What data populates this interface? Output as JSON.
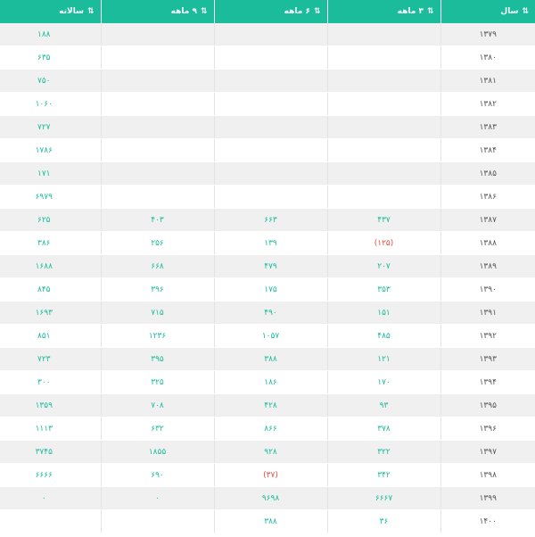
{
  "columns": {
    "year": "سال",
    "m3": "۳ ماهه",
    "m6": "۶ ماهه",
    "m9": "۹ ماهه",
    "annual": "سالانه"
  },
  "colors": {
    "header_bg": "#1abc9c",
    "value": "#1abc9c",
    "negative": "#e74c3c"
  },
  "icons": {
    "sort": "sort-arrows-icon"
  },
  "rows": [
    {
      "year": "۱۳۷۹",
      "m3": "",
      "m6": "",
      "m9": "",
      "annual": "۱۸۸"
    },
    {
      "year": "۱۳۸۰",
      "m3": "",
      "m6": "",
      "m9": "",
      "annual": "۶۳۵"
    },
    {
      "year": "۱۳۸۱",
      "m3": "",
      "m6": "",
      "m9": "",
      "annual": "۷۵۰"
    },
    {
      "year": "۱۳۸۲",
      "m3": "",
      "m6": "",
      "m9": "",
      "annual": "۱۰۶۰"
    },
    {
      "year": "۱۳۸۳",
      "m3": "",
      "m6": "",
      "m9": "",
      "annual": "۷۲۷"
    },
    {
      "year": "۱۳۸۴",
      "m3": "",
      "m6": "",
      "m9": "",
      "annual": "۱۷۸۶"
    },
    {
      "year": "۱۳۸۵",
      "m3": "",
      "m6": "",
      "m9": "",
      "annual": "۱۷۱"
    },
    {
      "year": "۱۳۸۶",
      "m3": "",
      "m6": "",
      "m9": "",
      "annual": "۶۹۷۹"
    },
    {
      "year": "۱۳۸۷",
      "m3": "۴۳۷",
      "m6": "۶۶۳",
      "m9": "۴۰۳",
      "annual": "۶۲۵"
    },
    {
      "year": "۱۳۸۸",
      "m3": "(۱۲۵)",
      "m6": "۱۳۹",
      "m9": "۲۵۶",
      "annual": "۳۸۶",
      "m3_neg": true
    },
    {
      "year": "۱۳۸۹",
      "m3": "۲۰۷",
      "m6": "۴۷۹",
      "m9": "۶۶۸",
      "annual": "۱۶۸۸"
    },
    {
      "year": "۱۳۹۰",
      "m3": "۳۵۳",
      "m6": "۱۷۵",
      "m9": "۳۹۶",
      "annual": "۸۴۵"
    },
    {
      "year": "۱۳۹۱",
      "m3": "۱۵۱",
      "m6": "۴۹۰",
      "m9": "۷۱۵",
      "annual": "۱۶۹۳"
    },
    {
      "year": "۱۳۹۲",
      "m3": "۴۸۵",
      "m6": "۱۰۵۷",
      "m9": "۱۲۳۶",
      "annual": "۸۵۱"
    },
    {
      "year": "۱۳۹۳",
      "m3": "۱۲۱",
      "m6": "۳۸۸",
      "m9": "۳۹۵",
      "annual": "۷۲۳"
    },
    {
      "year": "۱۳۹۴",
      "m3": "۱۷۰",
      "m6": "۱۸۶",
      "m9": "۳۲۵",
      "annual": "۳۰۰"
    },
    {
      "year": "۱۳۹۵",
      "m3": "۹۳",
      "m6": "۴۲۸",
      "m9": "۷۰۸",
      "annual": "۱۳۵۹"
    },
    {
      "year": "۱۳۹۶",
      "m3": "۳۷۸",
      "m6": "۸۶۶",
      "m9": "۶۳۲",
      "annual": "۱۱۱۳"
    },
    {
      "year": "۱۳۹۷",
      "m3": "۳۲۲",
      "m6": "۹۲۸",
      "m9": "۱۸۵۵",
      "annual": "۳۷۴۵"
    },
    {
      "year": "۱۳۹۸",
      "m3": "۳۴۲",
      "m6": "(۳۷)",
      "m9": "۶۹۰",
      "annual": "۶۶۶۶",
      "m6_neg": true
    },
    {
      "year": "۱۳۹۹",
      "m3": "۶۶۶۷",
      "m6": "۹۶۹۸",
      "m9": "۰",
      "annual": "۰"
    },
    {
      "year": "۱۴۰۰",
      "m3": "۳۶",
      "m6": "۳۸۸",
      "m9": "",
      "annual": ""
    }
  ]
}
